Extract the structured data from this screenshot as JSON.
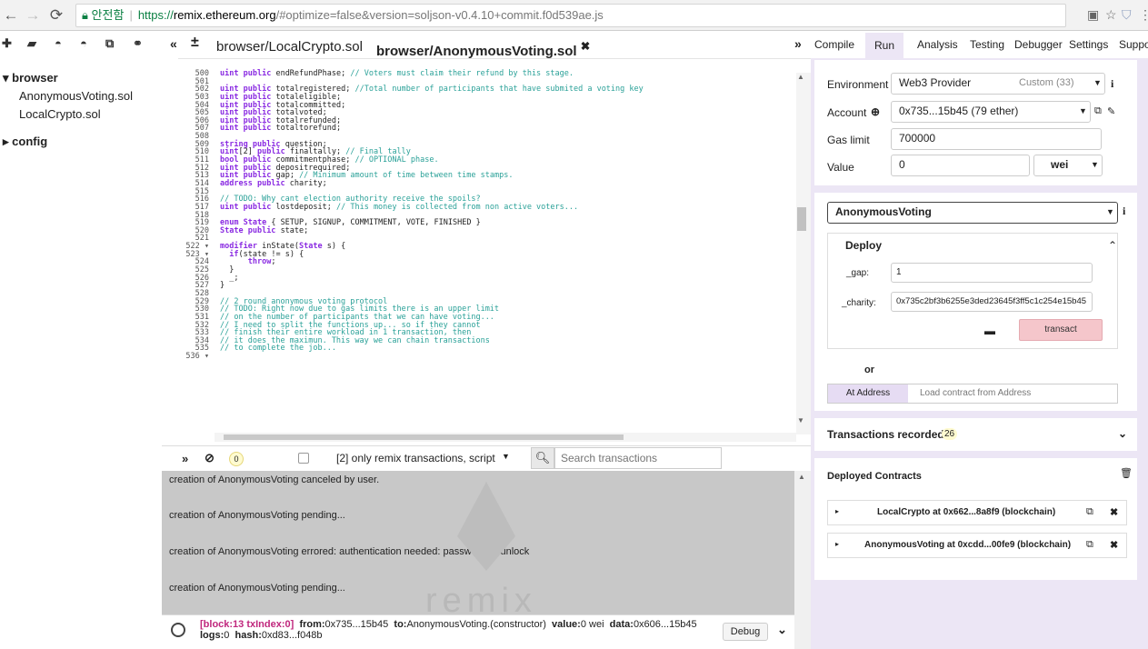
{
  "browser": {
    "secure_label": "안전함",
    "url_proto": "https://",
    "url_host": "remix.ethereum.org",
    "url_rest": "/#optimize=false&version=soljson-v0.4.10+commit.f0d539ae.js"
  },
  "file_tree": {
    "root": "browser",
    "files": [
      "AnonymousVoting.sol",
      "LocalCrypto.sol"
    ],
    "folder2": "config"
  },
  "tabs": [
    "browser/LocalCrypto.sol",
    "browser/AnonymousVoting.sol"
  ],
  "editor": {
    "line_numbers": [
      "500",
      "501",
      "502",
      "503",
      "504",
      "505",
      "506",
      "507",
      "508",
      "509",
      "510",
      "511",
      "512",
      "513",
      "514",
      "515",
      "516",
      "517",
      "518",
      "519",
      "520",
      "521",
      "522 ▾",
      "523 ▾",
      "524",
      "525",
      "526",
      "527",
      "528",
      "529",
      "530",
      "531",
      "532",
      "533",
      "534",
      "535",
      "536 ▾"
    ],
    "lines": [
      "uint public endRefundPhase; // Voters must claim their refund by this stage.",
      "",
      "uint public totalregistered; //Total number of participants that have submited a voting key",
      "uint public totaleligible;",
      "uint public totalcommitted;",
      "uint public totalvoted;",
      "uint public totalrefunded;",
      "uint public totaltorefund;",
      "",
      "string public question;",
      "uint[2] public finaltally; // Final tally",
      "bool public commitmentphase; // OPTIONAL phase.",
      "uint public depositrequired;",
      "uint public gap; // Minimum amount of time between time stamps.",
      "address public charity;",
      "",
      "// TODO: Why cant election authority receive the spoils?",
      "uint public lostdeposit; // This money is collected from non active voters...",
      "",
      "enum State { SETUP, SIGNUP, COMMITMENT, VOTE, FINISHED }",
      "State public state;",
      "",
      "modifier inState(State s) {",
      "  if(state != s) {",
      "      throw;",
      "  }",
      "  _;",
      "}",
      "",
      "// 2 round anonymous voting protocol",
      "// TODO: Right now due to gas limits there is an upper limit",
      "// on the number of participants that we can have voting...",
      "// I need to split the functions up... so if they cannot",
      "// finish their entire workload in 1 transaction, then",
      "// it does the maximun. This way we can chain transactions",
      "// to complete the job..."
    ]
  },
  "terminal": {
    "counter": "0",
    "filter_label": "[2] only remix transactions, script",
    "search_placeholder": "Search transactions",
    "logs": [
      "creation of AnonymousVoting canceled by user.",
      "creation of AnonymousVoting pending...",
      "creation of AnonymousVoting errored: authentication needed: password or unlock",
      "creation of AnonymousVoting pending..."
    ],
    "watermark": "remix",
    "tx": {
      "block": "[block:13 txIndex:0]",
      "from_label": "from:",
      "from": "0x735...15b45",
      "to_label": "to:",
      "to": "AnonymousVoting.(constructor)",
      "value_label": "value:",
      "value": "0 wei",
      "data_label": "data:",
      "data": "0x606...15b45",
      "logs_label": "logs:",
      "logs": "0",
      "hash_label": "hash:",
      "hash": "0xd83...f048b",
      "debug": "Debug"
    }
  },
  "right_tabs": [
    "Compile",
    "Run",
    "Analysis",
    "Testing",
    "Debugger",
    "Settings",
    "Suppo"
  ],
  "run": {
    "environment_label": "Environment",
    "environment_value": "Web3 Provider",
    "environment_extra": "Custom (33)",
    "account_label": "Account",
    "account_value": "0x735...15b45 (79 ether)",
    "gas_label": "Gas limit",
    "gas_value": "700000",
    "value_label": "Value",
    "value_value": "0",
    "value_unit": "wei",
    "contract_select": "AnonymousVoting",
    "deploy_title": "Deploy",
    "gap_label": "_gap:",
    "gap_value": "1",
    "charity_label": "_charity:",
    "charity_value": "0x735c2bf3b6255e3ded23645f3ff5c1c254e15b45",
    "transact": "transact",
    "or": "or",
    "at_address": "At Address",
    "load_placeholder": "Load contract from Address",
    "tx_recorded_label": "Transactions recorded:",
    "tx_recorded_count": "26",
    "deployed_title": "Deployed Contracts",
    "deployed": [
      "LocalCrypto at 0x662...8a8f9 (blockchain)",
      "AnonymousVoting at 0xcdd...00fe9 (blockchain)"
    ]
  }
}
